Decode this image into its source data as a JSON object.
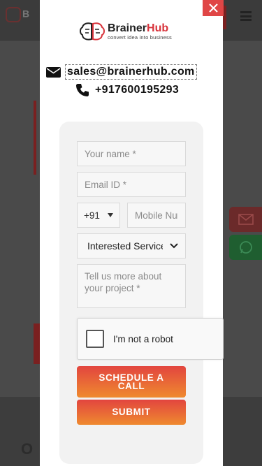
{
  "background": {
    "logo_text": "B",
    "lower_title": "O"
  },
  "modal": {
    "close_label": "×",
    "logo": {
      "title_part1": "Brainer",
      "title_part2": "Hub",
      "tagline": "convert idea into business"
    },
    "contact": {
      "email": "sales@brainerhub.com",
      "phone": "+917600195293"
    },
    "form": {
      "name_placeholder": "Your name *",
      "email_placeholder": "Email ID *",
      "country_code": "+91",
      "mobile_placeholder": "Mobile Number",
      "interest_selected": "Interested Service",
      "project_placeholder": "Tell us more about your project *",
      "captcha_label": "I'm not a robot",
      "schedule_label": "SCHEDULE A CALL",
      "submit_label": "SUBMIT"
    }
  },
  "colors": {
    "accent_red": "#e04646",
    "button_gradient_top": "#e2453f",
    "button_gradient_bottom": "#ef8a2f",
    "whatsapp_green": "#1f5e30"
  }
}
